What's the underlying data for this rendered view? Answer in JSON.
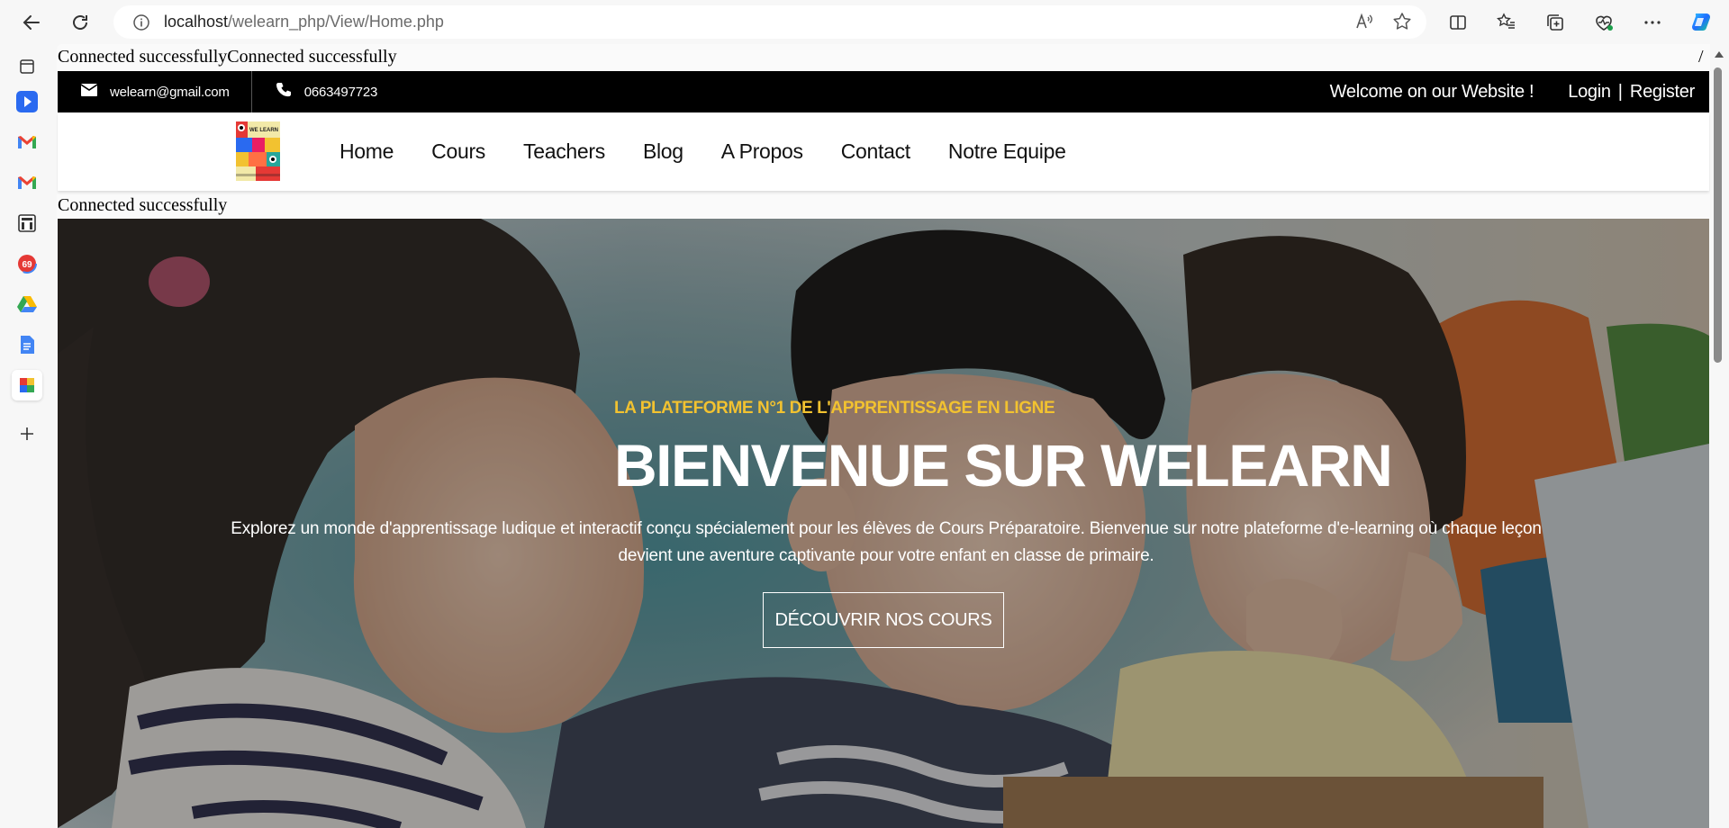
{
  "browser": {
    "url_host": "localhost",
    "url_path": "/welearn_php/View/Home.php"
  },
  "page": {
    "debug_top": "Connected successfullyConnected successfully",
    "debug_mid": "Connected successfully",
    "corner_slash": "/"
  },
  "topbar": {
    "email": "welearn@gmail.com",
    "phone": "0663497723",
    "welcome": "Welcome on our Website !",
    "login": "Login",
    "separator": "|",
    "register": "Register"
  },
  "nav": {
    "items": [
      "Home",
      "Cours",
      "Teachers",
      "Blog",
      "A Propos",
      "Contact",
      "Notre Equipe"
    ]
  },
  "hero": {
    "kicker": "LA PLATEFORME N°1 DE L'APPRENTISSAGE EN LIGNE",
    "title": "BIENVENUE SUR WELEARN",
    "description": "Explorez un monde d'apprentissage ludique et interactif conçu spécialement pour les élèves de Cours Préparatoire. Bienvenue sur notre plateforme d'e-learning où chaque leçon devient une aventure captivante pour votre enfant en classe de primaire.",
    "cta": "DÉCOUVRIR NOS COURS"
  },
  "colors": {
    "topbar_bg": "#000000",
    "kicker": "#f2c230",
    "nav_text": "#111111"
  }
}
